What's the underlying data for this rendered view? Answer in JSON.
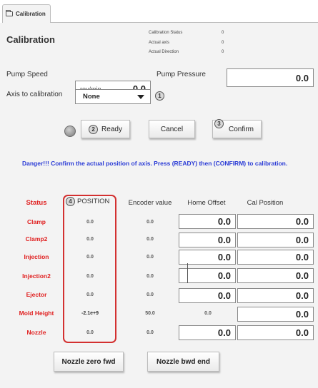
{
  "tab": {
    "label": "Calibration"
  },
  "header": {
    "title": "Calibration",
    "status_lines": [
      {
        "label": "Calibration Status",
        "value": "0"
      },
      {
        "label": "Actual axis",
        "value": "0"
      },
      {
        "label": "Actual Direction",
        "value": "0"
      }
    ]
  },
  "pump_speed": {
    "label": "Pump Speed",
    "unit": "rev/min",
    "value": "0.0"
  },
  "pump_pressure": {
    "label": "Pump Pressure",
    "value": "0.0"
  },
  "axis": {
    "label": "Axis to calibration",
    "selected": "None",
    "step": "1"
  },
  "buttons": {
    "ready": {
      "label": "Ready",
      "step": "2"
    },
    "cancel": {
      "label": "Cancel"
    },
    "confirm": {
      "label": "Confirm",
      "step": "3"
    },
    "nozzle_zero_fwd": "Nozzle zero fwd",
    "nozzle_bwd_end": "Nozzle bwd end"
  },
  "danger_message": "Danger!!! Confirm the actual position of axis. Press (READY) then (CONFIRM) to calibration.",
  "table": {
    "headers": {
      "status": "Status",
      "position": "POSITION",
      "position_step": "4",
      "encoder": "Encoder value",
      "home_offset": "Home Offset",
      "cal_position": "Cal Position"
    },
    "rows": [
      {
        "name": "Clamp",
        "position": "0.0",
        "encoder": "0.0",
        "home_offset": "0.0",
        "cal_position": "0.0"
      },
      {
        "name": "Clamp2",
        "position": "0.0",
        "encoder": "0.0",
        "home_offset": "0.0",
        "cal_position": "0.0"
      },
      {
        "name": "Injection",
        "position": "0.0",
        "encoder": "0.0",
        "home_offset": "0.0",
        "cal_position": "0.0"
      },
      {
        "name": "Injection2",
        "position": "0.0",
        "encoder": "0.0",
        "home_offset": "0.0",
        "cal_position": "0.0"
      },
      {
        "name": "Ejector",
        "position": "0.0",
        "encoder": "0.0",
        "home_offset": "0.0",
        "cal_position": "0.0"
      },
      {
        "name": "Mold Height",
        "position": "-2.1e+9",
        "encoder": "50.0",
        "home_offset": "0.0",
        "cal_position": "0.0"
      },
      {
        "name": "Nozzle",
        "position": "0.0",
        "encoder": "0.0",
        "home_offset": "0.0",
        "cal_position": "0.0"
      }
    ]
  },
  "colors": {
    "danger_text": "#2a3bd6",
    "status_red": "#e02020",
    "highlight_frame": "#d33030"
  }
}
